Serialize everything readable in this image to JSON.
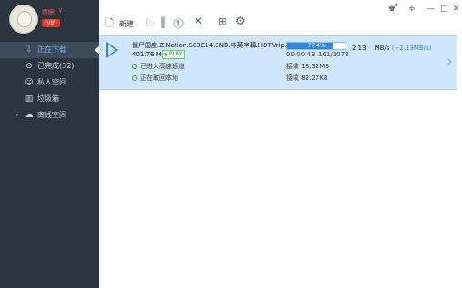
{
  "user": {
    "name": "赘眠",
    "gender": "♀",
    "vip": "VIP"
  },
  "nav": {
    "items": [
      {
        "label": "正在下载",
        "icon": "download-icon"
      },
      {
        "label": "已完成(32)",
        "icon": "check-icon"
      },
      {
        "label": "私人空间",
        "icon": "user-icon"
      },
      {
        "label": "垃圾箱",
        "icon": "trash-icon"
      },
      {
        "label": "离线空间",
        "icon": "cloud-icon"
      }
    ]
  },
  "toolbar": {
    "new_label": "新建"
  },
  "task": {
    "filename": "僵尸国度.Z.Nation.S03E14.END.中英字幕.HDTVrip.1024...",
    "size": "401.76 MB",
    "play_badge": "PLAY",
    "progress_percent": 77.4,
    "progress_label": "77.4%",
    "elapsed": "00:00:43",
    "pieces": "161/1078",
    "speed": "2.13",
    "speed_unit": "MB/s",
    "boost": "(+2.13MB/s)",
    "status1": "已进入高速通道",
    "status2": "正在取回本地",
    "received1": "接收 18.32MB",
    "received2": "接收 82.27KB"
  },
  "colors": {
    "sidebar": "#2b3540",
    "accent": "#2e86de",
    "row_bg": "#cfe6fb",
    "vip": "#e03a2a"
  }
}
